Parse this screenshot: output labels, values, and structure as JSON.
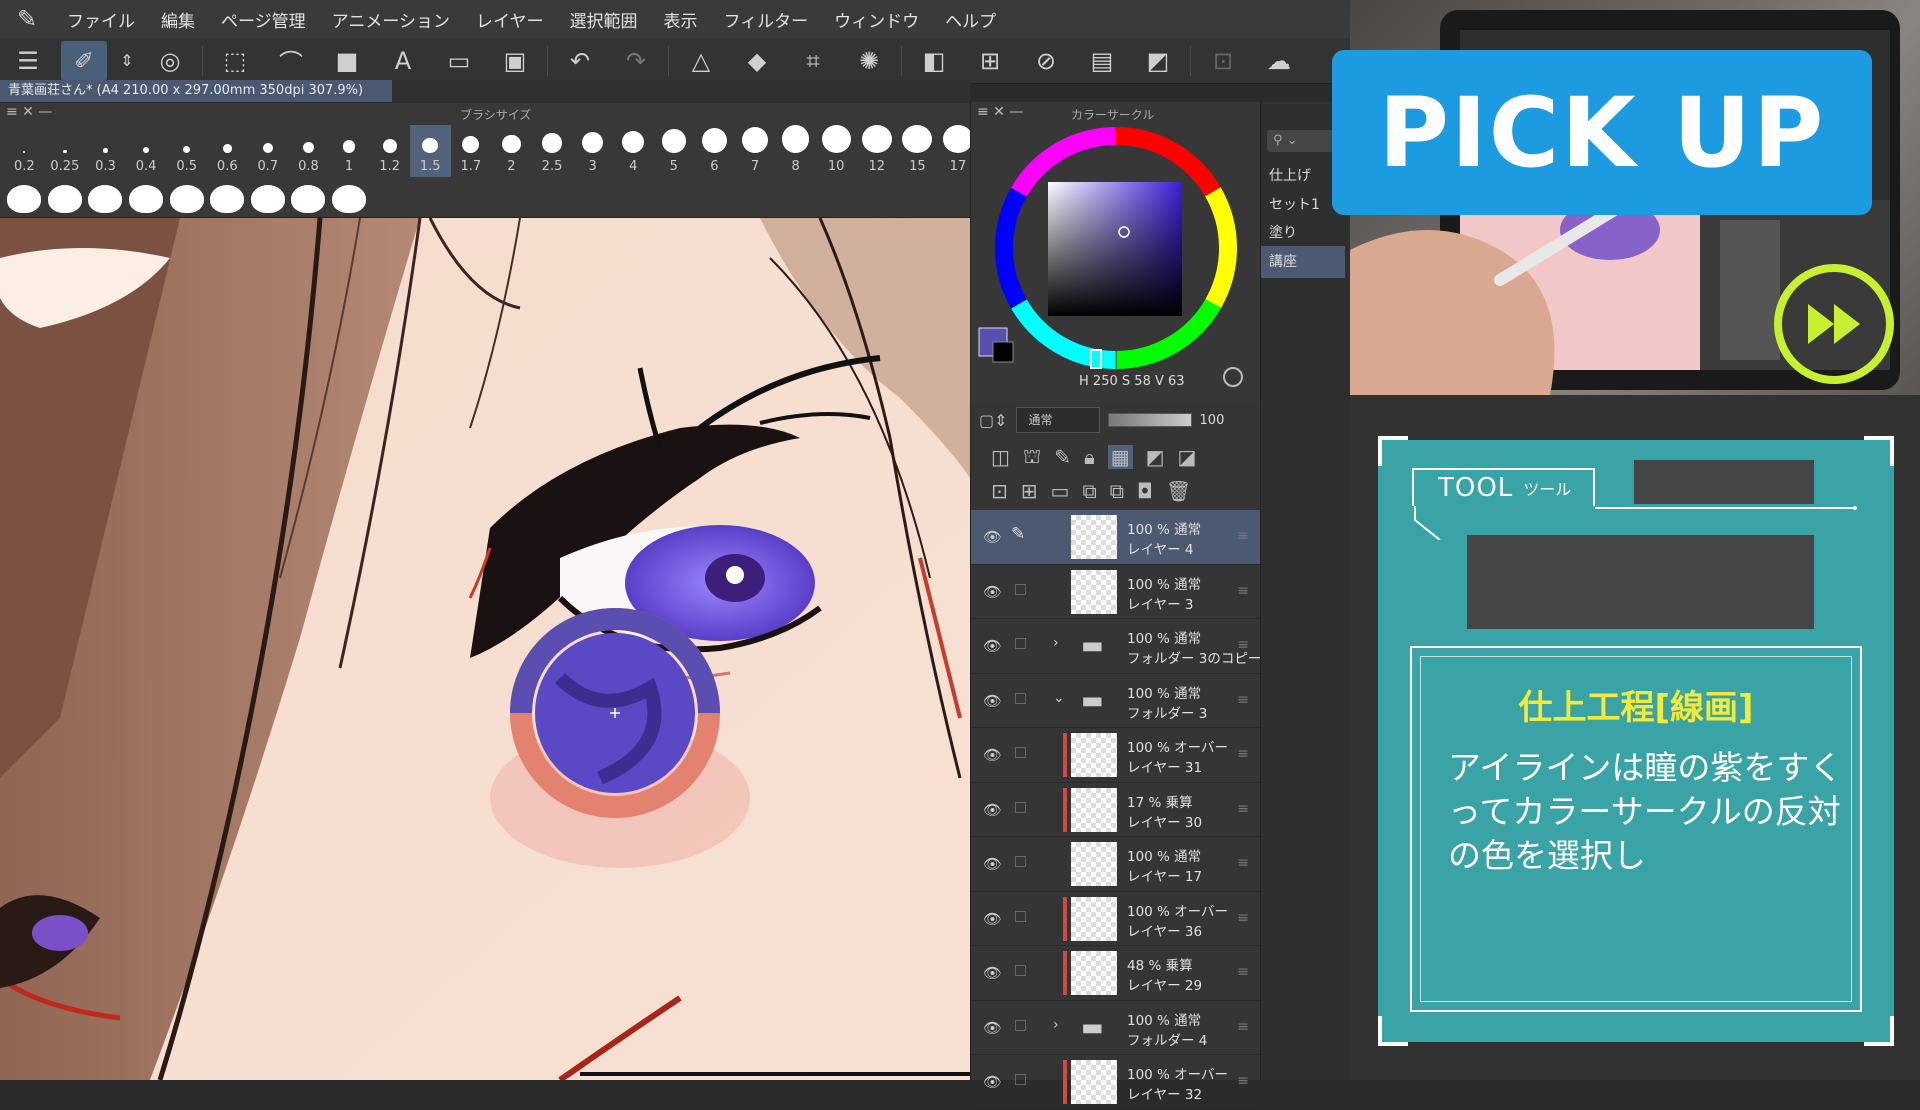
{
  "menubar": {
    "logo_icon": "clip-studio-logo-icon",
    "items": [
      "ファイル",
      "編集",
      "ページ管理",
      "アニメーション",
      "レイヤー",
      "選択範囲",
      "表示",
      "フィルター",
      "ウィンドウ",
      "ヘルプ"
    ]
  },
  "toolbar": {
    "icons": [
      "menu-icon",
      "eyedropper-icon",
      "arrows-icon",
      "spiral-icon",
      "select-icon",
      "lasso-icon",
      "fill-square-icon",
      "text-icon",
      "folder-icon",
      "frame-icon",
      "undo-icon",
      "redo-icon",
      "shape-icon",
      "bucket-icon",
      "transform-icon",
      "loading-icon",
      "invert-icon",
      "grid-icon",
      "eraser-icon",
      "layers-icon",
      "edit-icon",
      "settings-icon",
      "cloud-icon"
    ]
  },
  "document": {
    "tab_title": "青葉画荘さん* (A4 210.00 x 297.00mm 350dpi 307.9%)"
  },
  "brush_panel": {
    "title": "ブラシサイズ",
    "sizes": [
      "0.2",
      "0.25",
      "0.3",
      "0.4",
      "0.5",
      "0.6",
      "0.7",
      "0.8",
      "1",
      "1.2",
      "1.5",
      "1.7",
      "2",
      "2.5",
      "3",
      "4",
      "5",
      "6",
      "7",
      "8",
      "10",
      "12",
      "15",
      "17"
    ],
    "selected": "1.5"
  },
  "color_panel": {
    "title": "カラーサークル",
    "current_color": "#5a4fb0",
    "hsv": {
      "h": "250",
      "s": "58",
      "v": "63"
    },
    "h_label": "H",
    "s_label": "S",
    "v_label": "V"
  },
  "layer_panel": {
    "blend_mode": "通常",
    "opacity": "100",
    "layers": [
      {
        "mode": "100 % 通常",
        "name": "レイヤー 4",
        "type": "layer",
        "selected": true,
        "clip": false
      },
      {
        "mode": "100 % 通常",
        "name": "レイヤー 3",
        "type": "layer",
        "selected": false,
        "clip": false
      },
      {
        "mode": "100 % 通常",
        "name": "フォルダー 3のコピー",
        "type": "folder-closed",
        "selected": false,
        "clip": false
      },
      {
        "mode": "100 % 通常",
        "name": "フォルダー 3",
        "type": "folder-open",
        "selected": false,
        "clip": false
      },
      {
        "mode": "100 % オーバー",
        "name": "レイヤー 31",
        "type": "layer",
        "selected": false,
        "clip": true
      },
      {
        "mode": "17 % 乗算",
        "name": "レイヤー 30",
        "type": "layer",
        "selected": false,
        "clip": true
      },
      {
        "mode": "100 % 通常",
        "name": "レイヤー 17",
        "type": "layer",
        "selected": false,
        "clip": false
      },
      {
        "mode": "100 % オーバー",
        "name": "レイヤー 36",
        "type": "layer",
        "selected": false,
        "clip": true
      },
      {
        "mode": "48 % 乗算",
        "name": "レイヤー 29",
        "type": "layer",
        "selected": false,
        "clip": true
      },
      {
        "mode": "100 % 通常",
        "name": "フォルダー 4",
        "type": "folder-closed",
        "selected": false,
        "clip": false
      },
      {
        "mode": "100 % オーバー",
        "name": "レイヤー 32",
        "type": "layer",
        "selected": false,
        "clip": true
      }
    ]
  },
  "subtool": {
    "items": [
      "仕上げ",
      "セット1",
      "塗り",
      "講座"
    ],
    "selected": "講座"
  },
  "overlay": {
    "pickup_text": "PICK UP",
    "play_icon": "fast-forward-icon",
    "accent_color": "#1d9be0",
    "play_color": "#c6f030"
  },
  "tool_card": {
    "tab_en": "TOOL",
    "tab_jp": "ツール",
    "tip_title": "仕上工程[線画]",
    "tip_body": "アイラインは瞳の紫をすくってカラーサークルの反対の色を選択し",
    "card_color": "#3aa3a5",
    "title_color": "#f4ea3a"
  }
}
